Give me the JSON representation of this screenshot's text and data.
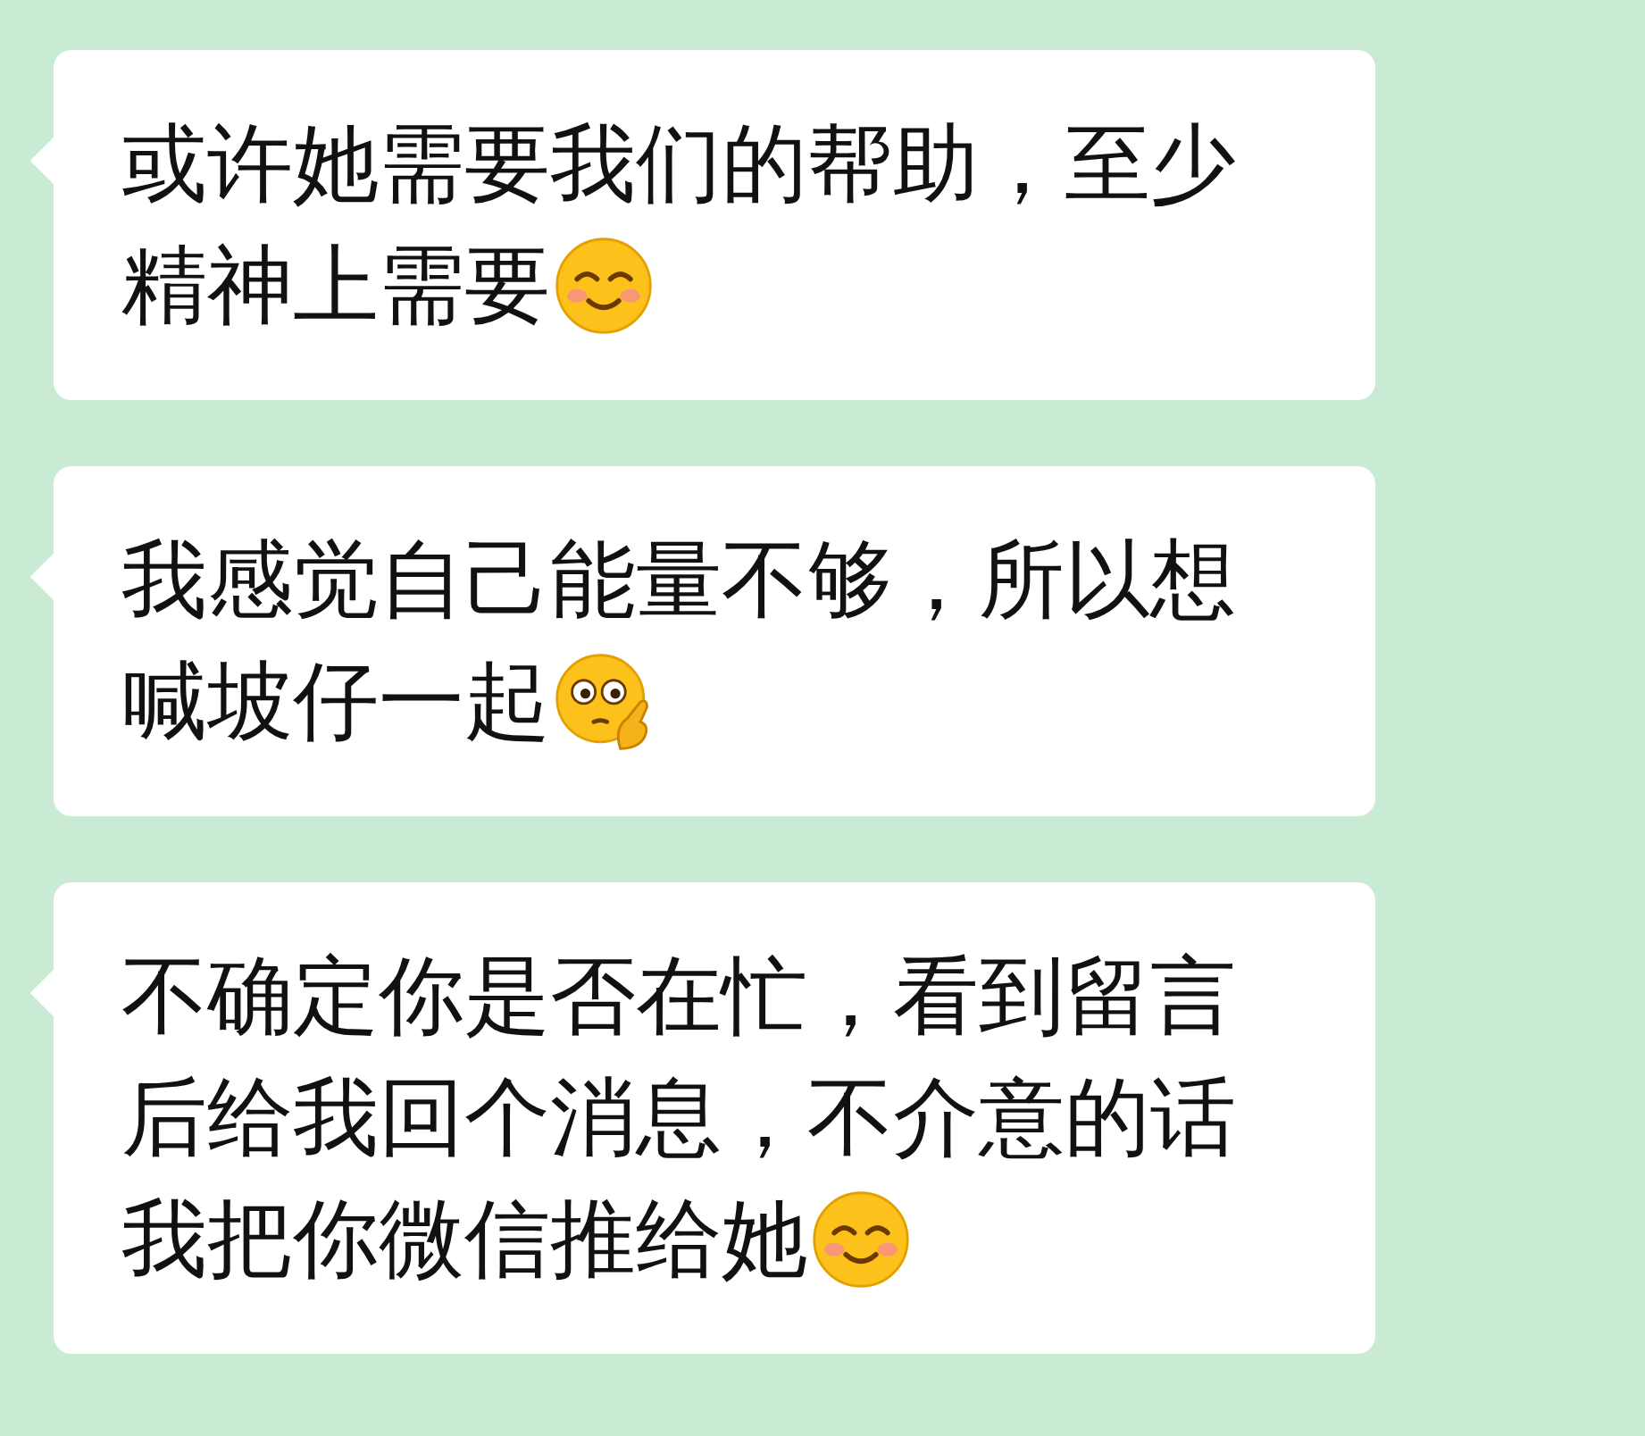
{
  "messages": [
    {
      "lines": [
        [
          {
            "kind": "text",
            "text": "或许她需要我们的帮助，至少"
          }
        ],
        [
          {
            "kind": "text",
            "text": "精神上需要"
          },
          {
            "kind": "smile"
          }
        ]
      ]
    },
    {
      "lines": [
        [
          {
            "kind": "text",
            "text": "我感觉自己能量不够，所以想"
          }
        ],
        [
          {
            "kind": "text",
            "text": "喊坡仔一起"
          },
          {
            "kind": "ponder"
          }
        ]
      ]
    },
    {
      "lines": [
        [
          {
            "kind": "text",
            "text": "不确定你是否在忙，看到留言"
          }
        ],
        [
          {
            "kind": "text",
            "text": "后给我回个消息，不介意的话"
          }
        ],
        [
          {
            "kind": "text",
            "text": "我把你微信推给她"
          },
          {
            "kind": "smile"
          }
        ]
      ]
    }
  ]
}
